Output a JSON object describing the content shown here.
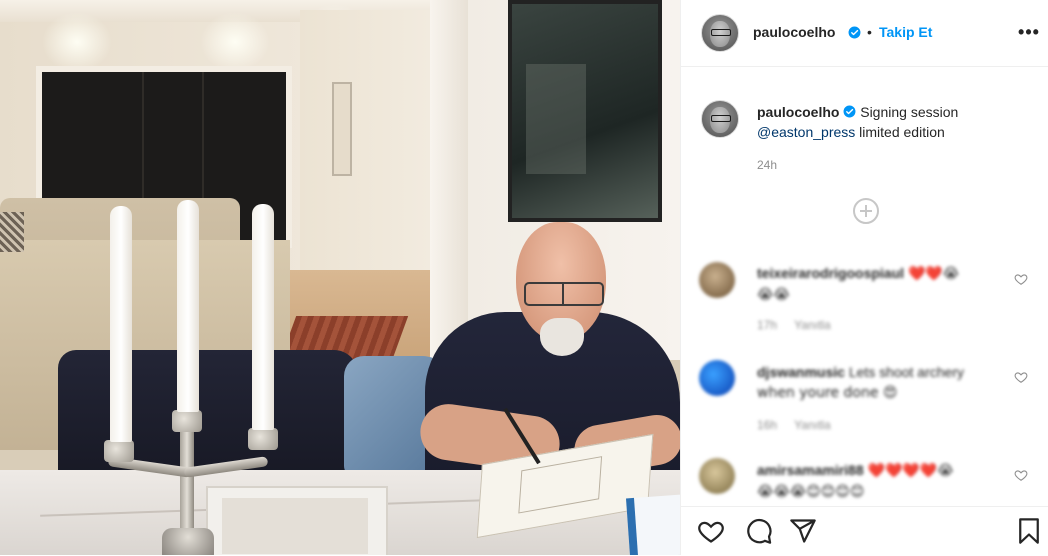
{
  "post": {
    "username": "paulocoelho",
    "follow_label": "Takip Et",
    "separator": "•",
    "more_label": "•••",
    "caption_text": "Signing session",
    "caption_mention": "@easton_press",
    "caption_tail": "limited edition",
    "time": "24h"
  },
  "comments": [
    {
      "username": "teixeirarodrigoospiaul",
      "text": "❤️❤️😭",
      "text2": "😭😭",
      "time": "17h",
      "reply_label": "Yanıtla"
    },
    {
      "username": "djswanmusic",
      "text": "Lets shoot archery",
      "text2": "when youre done 😍",
      "time": "16h",
      "reply_label": "Yanıtla"
    },
    {
      "username": "amirsamamiri88",
      "text": "❤️❤️❤️❤️😭",
      "text2": "😭😭😭😊😊😊😊",
      "time": "",
      "reply_label": ""
    }
  ],
  "colors": {
    "accent": "#0095f6",
    "mention": "#00376b",
    "muted": "#8e8e8e",
    "heart": "#ed4956"
  },
  "icons": [
    "verified-badge-icon",
    "more-options-icon",
    "add-circle-icon",
    "heart-icon",
    "comment-icon",
    "share-icon",
    "bookmark-icon"
  ]
}
